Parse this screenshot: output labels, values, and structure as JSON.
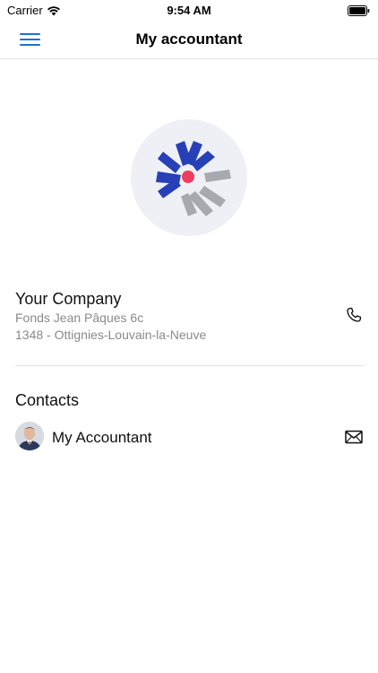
{
  "status_bar": {
    "carrier": "Carrier",
    "time": "9:54 AM"
  },
  "nav": {
    "title": "My accountant",
    "menu_icon": "hamburger-menu-icon"
  },
  "logo": {
    "icon": "company-logo",
    "colors": {
      "blue": "#2740b8",
      "gray": "#a7a9ae",
      "dot": "#ec3d5f"
    }
  },
  "company": {
    "name": "Your Company",
    "address_line1": "Fonds Jean Pâques 6c",
    "address_line2": "1348 - Ottignies-Louvain-la-Neuve",
    "phone_icon": "phone-icon"
  },
  "contacts": {
    "heading": "Contacts",
    "items": [
      {
        "name": "My Accountant",
        "avatar": "avatar-photo",
        "action_icon": "mail-icon"
      }
    ]
  },
  "colors": {
    "accent": "#1e6fd9",
    "text_primary": "#111111",
    "text_secondary": "#8a8a8a",
    "divider": "#e0e0e0"
  }
}
